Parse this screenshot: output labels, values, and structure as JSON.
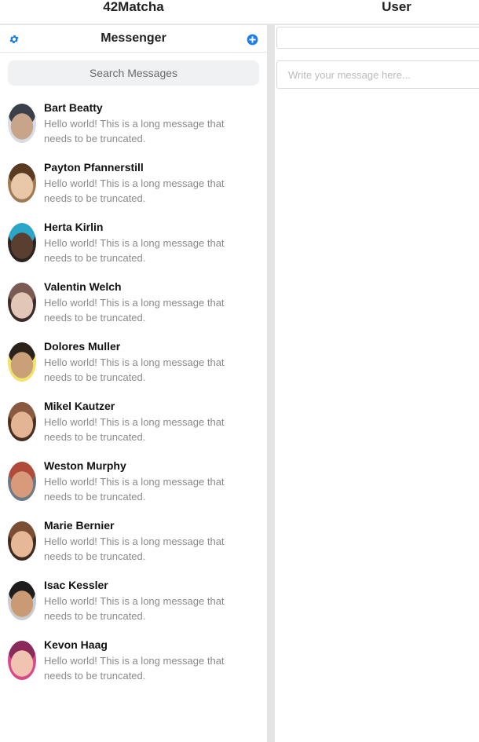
{
  "header": {
    "app_title": "42Matcha",
    "user_title": "User"
  },
  "messenger": {
    "title": "Messenger",
    "settings_icon": "gear-icon",
    "new_message_icon": "plus-circle-icon",
    "accent_color": "#1b7ee8",
    "search_placeholder": "Search Messages"
  },
  "conversations": [
    {
      "name": "Bart Beatty",
      "preview": "Hello world! This is a long message that needs to be truncated.",
      "avatar_colors": [
        "#d9dde3",
        "#c7a48a",
        "#3a3f4a"
      ]
    },
    {
      "name": "Payton Pfannerstill",
      "preview": "Hello world! This is a long message that needs to be truncated.",
      "avatar_colors": [
        "#a07a52",
        "#e8c8a8",
        "#5a3a20"
      ]
    },
    {
      "name": "Herta Kirlin",
      "preview": "Hello world! This is a long message that needs to be truncated.",
      "avatar_colors": [
        "#2b2320",
        "#5a3e30",
        "#2aa6c8"
      ]
    },
    {
      "name": "Valentin Welch",
      "preview": "Hello world! This is a long message that needs to be truncated.",
      "avatar_colors": [
        "#3b2b2a",
        "#e2c7b8",
        "#7a5a52"
      ]
    },
    {
      "name": "Dolores Muller",
      "preview": "Hello world! This is a long message that needs to be truncated.",
      "avatar_colors": [
        "#f1e36a",
        "#caa079",
        "#2b221c"
      ]
    },
    {
      "name": "Mikel Kautzer",
      "preview": "Hello world! This is a long message that needs to be truncated.",
      "avatar_colors": [
        "#4a2e20",
        "#e3b595",
        "#8a5a40"
      ]
    },
    {
      "name": "Weston Murphy",
      "preview": "Hello world! This is a long message that needs to be truncated.",
      "avatar_colors": [
        "#6d7a86",
        "#d89a7a",
        "#b04a3a"
      ]
    },
    {
      "name": "Marie Bernier",
      "preview": "Hello world! This is a long message that needs to be truncated.",
      "avatar_colors": [
        "#3e2a1e",
        "#e6b898",
        "#7a4e32"
      ]
    },
    {
      "name": "Isac Kessler",
      "preview": "Hello world! This is a long message that needs to be truncated.",
      "avatar_colors": [
        "#c9ccd2",
        "#c99a74",
        "#1e1c1c"
      ]
    },
    {
      "name": "Kevon Haag",
      "preview": "Hello world! This is a long message that needs to be truncated.",
      "avatar_colors": [
        "#d84a8a",
        "#f0c4b0",
        "#8a2a5a"
      ]
    }
  ],
  "chat": {
    "compose_placeholder": "Write your message here..."
  }
}
